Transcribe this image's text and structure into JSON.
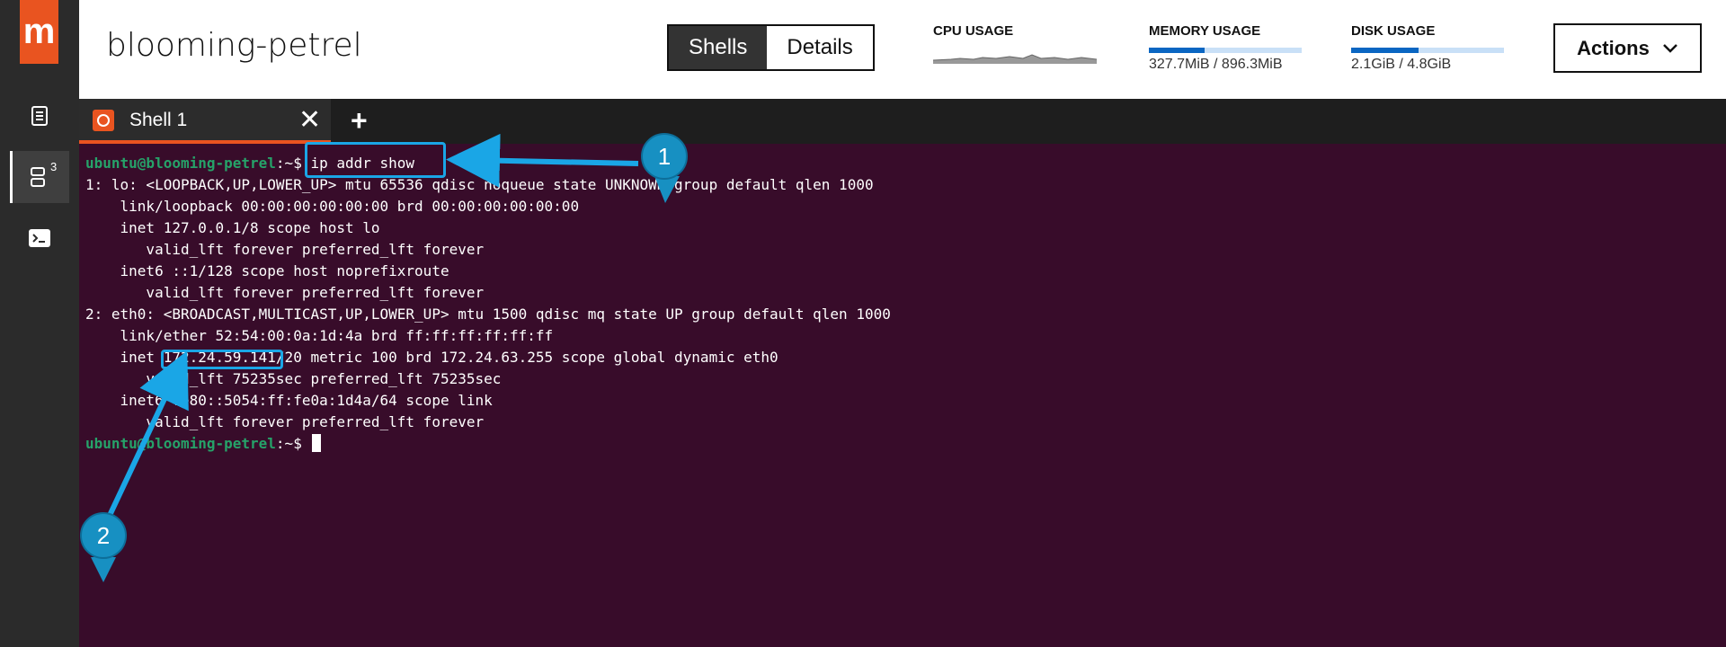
{
  "app": {
    "logo_glyph": "m"
  },
  "rail": {
    "shells_badge": "3"
  },
  "header": {
    "instance_name": "blooming-petrel",
    "tabs": [
      "Shells",
      "Details"
    ],
    "active_tab": "Shells",
    "cpu": {
      "title": "CPU USAGE"
    },
    "memory": {
      "title": "MEMORY USAGE",
      "value": "327.7MiB / 896.3MiB",
      "fraction": 0.366
    },
    "disk": {
      "title": "DISK USAGE",
      "value": "2.1GiB / 4.8GiB",
      "fraction": 0.44
    },
    "actions_label": "Actions"
  },
  "tabbar": {
    "tab_label": "Shell 1",
    "close_glyph": "✕",
    "add_glyph": "+"
  },
  "terminal": {
    "prompt_user": "ubuntu@blooming-petrel",
    "prompt_suffix": ":~$ ",
    "command": "ip addr show",
    "lines": [
      "1: lo: <LOOPBACK,UP,LOWER_UP> mtu 65536 qdisc noqueue state UNKNOWN group default qlen 1000",
      "    link/loopback 00:00:00:00:00:00 brd 00:00:00:00:00:00",
      "    inet 127.0.0.1/8 scope host lo",
      "       valid_lft forever preferred_lft forever",
      "    inet6 ::1/128 scope host noprefixroute",
      "       valid_lft forever preferred_lft forever",
      "2: eth0: <BROADCAST,MULTICAST,UP,LOWER_UP> mtu 1500 qdisc mq state UP group default qlen 1000",
      "    link/ether 52:54:00:0a:1d:4a brd ff:ff:ff:ff:ff:ff",
      "    inet 172.24.59.141/20 metric 100 brd 172.24.63.255 scope global dynamic eth0",
      "       valid_lft 75235sec preferred_lft 75235sec",
      "    inet6 fe80::5054:ff:fe0a:1d4a/64 scope link",
      "       valid_lft forever preferred_lft forever"
    ]
  },
  "annotations": {
    "callout_1": "1",
    "callout_2": "2"
  }
}
